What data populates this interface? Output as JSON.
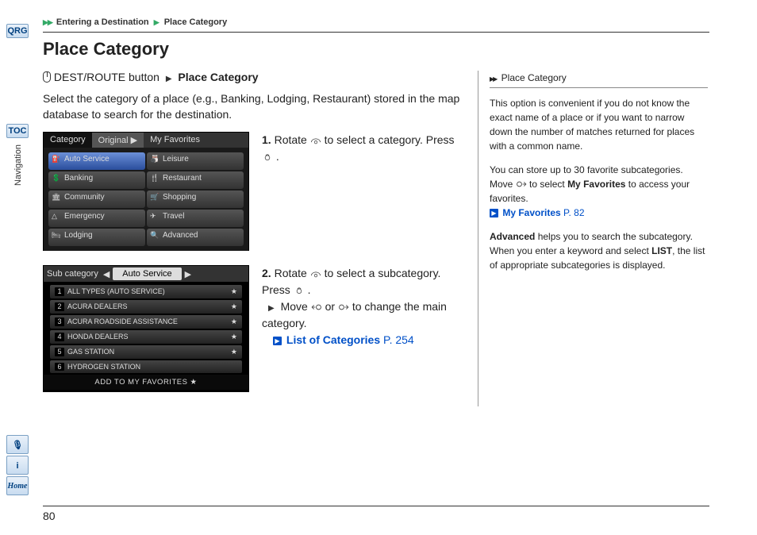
{
  "sidebar": {
    "qrg": "QRG",
    "toc": "TOC",
    "section": "Navigation",
    "voice": "🎙",
    "info": "i",
    "home": "Home"
  },
  "breadcrumb": {
    "a": "Entering a Destination",
    "b": "Place Category"
  },
  "title": "Place Category",
  "dest": {
    "label": "DEST/ROUTE button",
    "target": "Place Category"
  },
  "intro": "Select the category of a place (e.g., Banking, Lodging, Restaurant) stored in the map database to search for the destination.",
  "shot1": {
    "tabs": {
      "cat": "Category",
      "orig": "Original ▶",
      "fav": "My Favorites"
    },
    "cells": [
      "Auto Service",
      "Leisure",
      "Banking",
      "Restaurant",
      "Community",
      "Shopping",
      "Emergency",
      "Travel",
      "Lodging",
      "Advanced"
    ]
  },
  "shot2": {
    "top_label": "Sub category",
    "top_sel": "Auto Service",
    "rows": [
      {
        "n": "1",
        "t": "ALL TYPES (AUTO SERVICE)",
        "s": "★"
      },
      {
        "n": "2",
        "t": "ACURA DEALERS",
        "s": "★"
      },
      {
        "n": "3",
        "t": "ACURA ROADSIDE ASSISTANCE",
        "s": "★"
      },
      {
        "n": "4",
        "t": "HONDA DEALERS",
        "s": "★"
      },
      {
        "n": "5",
        "t": "GAS STATION",
        "s": "★"
      },
      {
        "n": "6",
        "t": "HYDROGEN STATION",
        "s": ""
      }
    ],
    "bottom": "ADD TO MY FAVORITES   ★"
  },
  "step1": {
    "a": "Rotate ",
    "b": " to select a category. Press ",
    "c": "."
  },
  "step2": {
    "a": "Rotate ",
    "b": " to select a subcategory. Press ",
    "c": ".",
    "d": "Move ",
    "e": " or ",
    "f": " to change the main category.",
    "link": "List of Categories",
    "page": "P. 254"
  },
  "side": {
    "h": "Place Category",
    "p1": "This option is convenient if you do not know the exact name of a place or if you want to narrow down the number of matches returned for places with a common name.",
    "p2a": "You can store up to 30 favorite subcategories. Move ",
    "p2b": " to select ",
    "p2c": "My Favorites",
    "p2d": " to access your favorites.",
    "link1": "My Favorites",
    "link1p": "P. 82",
    "p3a": "Advanced",
    "p3b": " helps you to search the subcategory. When you enter a keyword and select ",
    "p3c": "LIST",
    "p3d": ", the list of appropriate subcategories is displayed."
  },
  "pagenum": "80"
}
